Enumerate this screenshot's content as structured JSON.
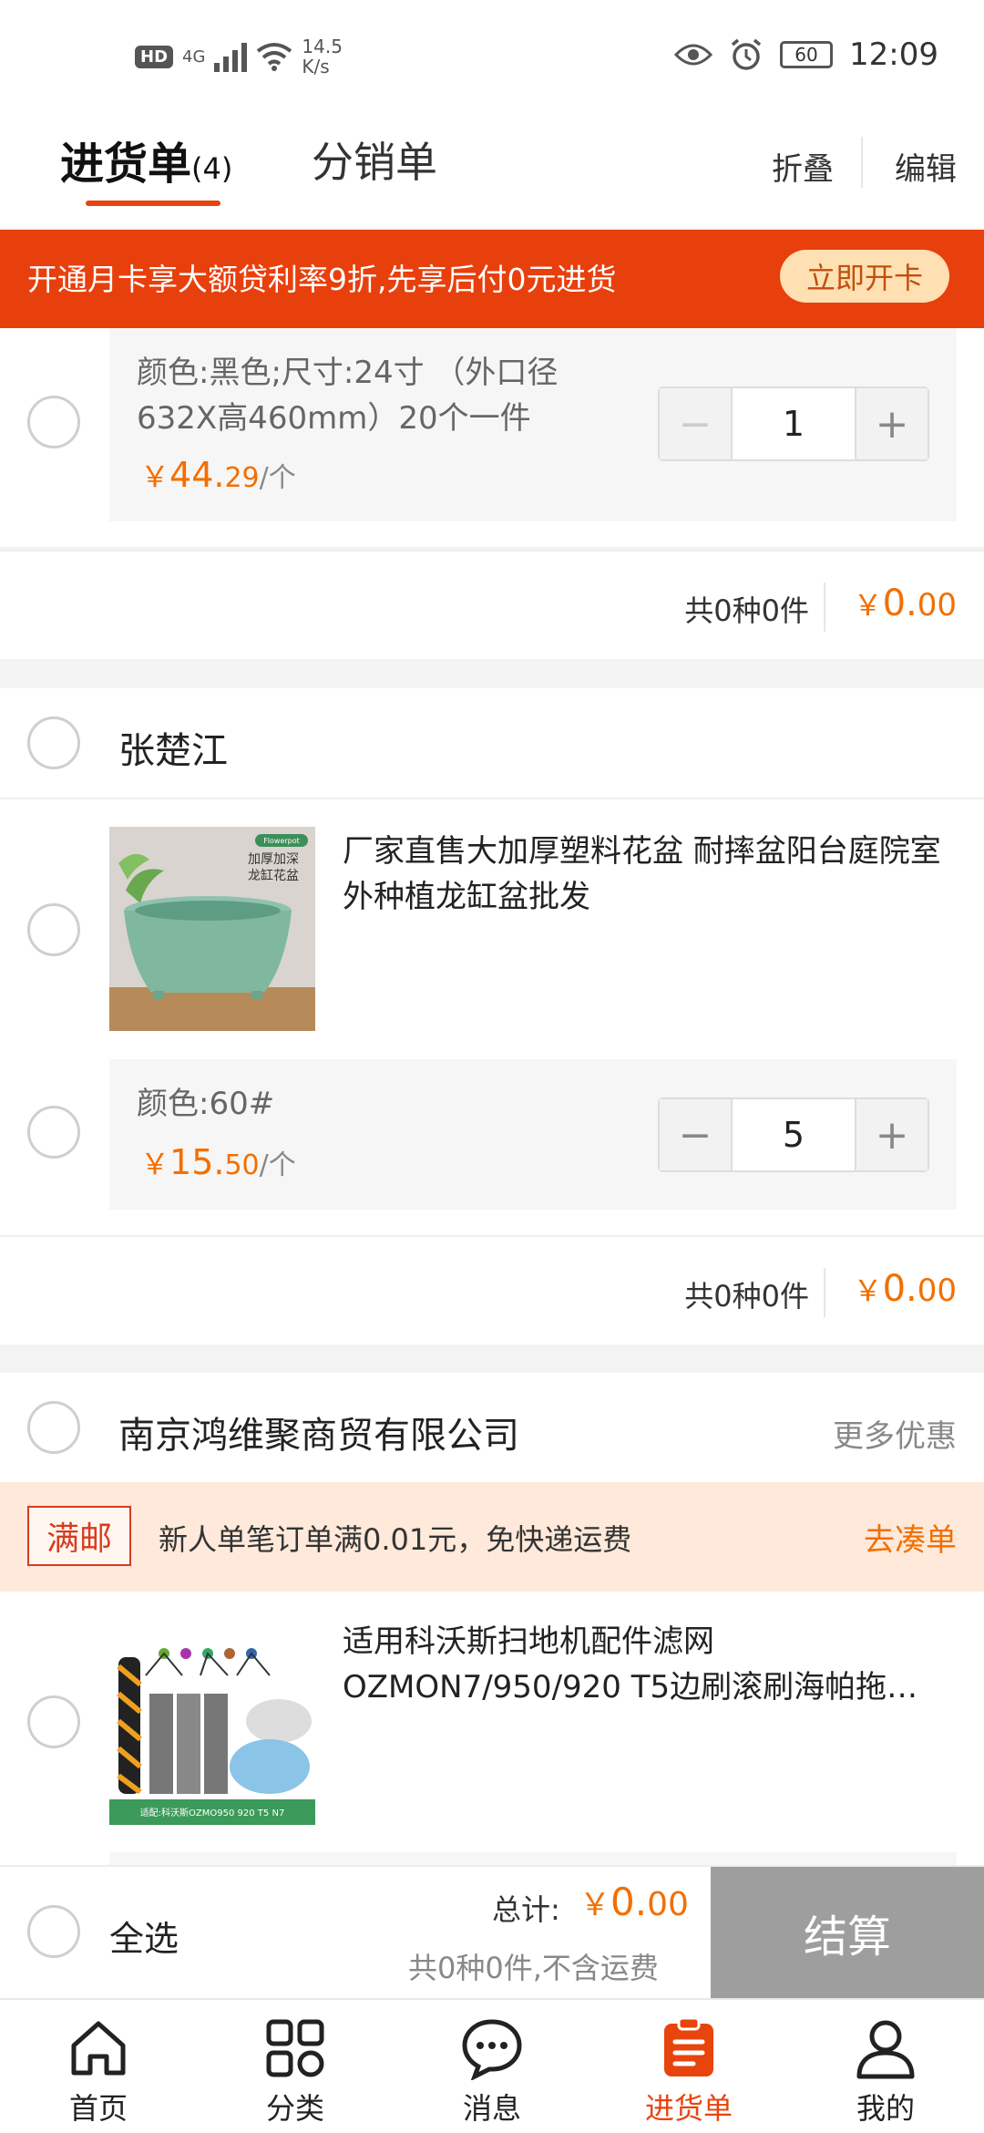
{
  "status_bar": {
    "hd": "HD",
    "network": "4G",
    "speed": "14.5",
    "speed_unit": "K/s",
    "battery": "60",
    "time": "12:09"
  },
  "header": {
    "tab_active": "进货单",
    "tab_active_count": "(4)",
    "tab_other": "分销单",
    "fold": "折叠",
    "edit": "编辑"
  },
  "banner": {
    "text": "开通月卡享大额贷利率9折,先享后付0元进货",
    "button": "立即开卡"
  },
  "shop1": {
    "sku_spec_line1": "颜色:黑色;尺寸:24寸 （外口径",
    "sku_spec_line2": "632X高460mm）20个一件",
    "price_yen": "￥",
    "price_int": "44.",
    "price_dec": "29",
    "price_unit": "/个",
    "qty": "1",
    "total_label": "共0种0件",
    "total_yen": "￥",
    "total_int": "0.",
    "total_dec": "00"
  },
  "shop2": {
    "name": "张楚江",
    "product_title": "厂家直售大加厚塑料花盆 耐摔盆阳台庭院室外种植龙缸盆批发",
    "image_badge": "Flowerpot",
    "image_text1": "加厚加深",
    "image_text2": "龙缸花盆",
    "sku_spec": "颜色:60#",
    "price_yen": "￥",
    "price_int": "15.",
    "price_dec": "50",
    "price_unit": "/个",
    "qty": "5",
    "total_label": "共0种0件",
    "total_yen": "￥",
    "total_int": "0.",
    "total_dec": "00"
  },
  "shop3": {
    "name": "南京鸿维聚商贸有限公司",
    "more": "更多优惠",
    "promo_tag": "满邮",
    "promo_text": "新人单笔订单满0.01元，免快递运费",
    "promo_link": "去凑单",
    "product_title_line1": "适用科沃斯扫地机配件滤网",
    "product_title_line2": "OZMON7/950/920 T5边刷滚刷海帕拖…",
    "image_caption": "适配:科沃斯OZMO950 920 T5 N7"
  },
  "settle": {
    "select_all": "全选",
    "total_label": "总计:",
    "total_yen": "￥",
    "total_int": "0.",
    "total_dec": "00",
    "note": "共0种0件,不含运费",
    "button": "结算"
  },
  "tabbar": [
    {
      "label": "首页",
      "icon": "home-icon"
    },
    {
      "label": "分类",
      "icon": "category-icon"
    },
    {
      "label": "消息",
      "icon": "message-icon"
    },
    {
      "label": "进货单",
      "icon": "purchase-list-icon",
      "active": true
    },
    {
      "label": "我的",
      "icon": "profile-icon"
    }
  ],
  "colors": {
    "accent": "#e8440e",
    "price": "#f36f00",
    "settle_disabled": "#9e9e9e"
  }
}
